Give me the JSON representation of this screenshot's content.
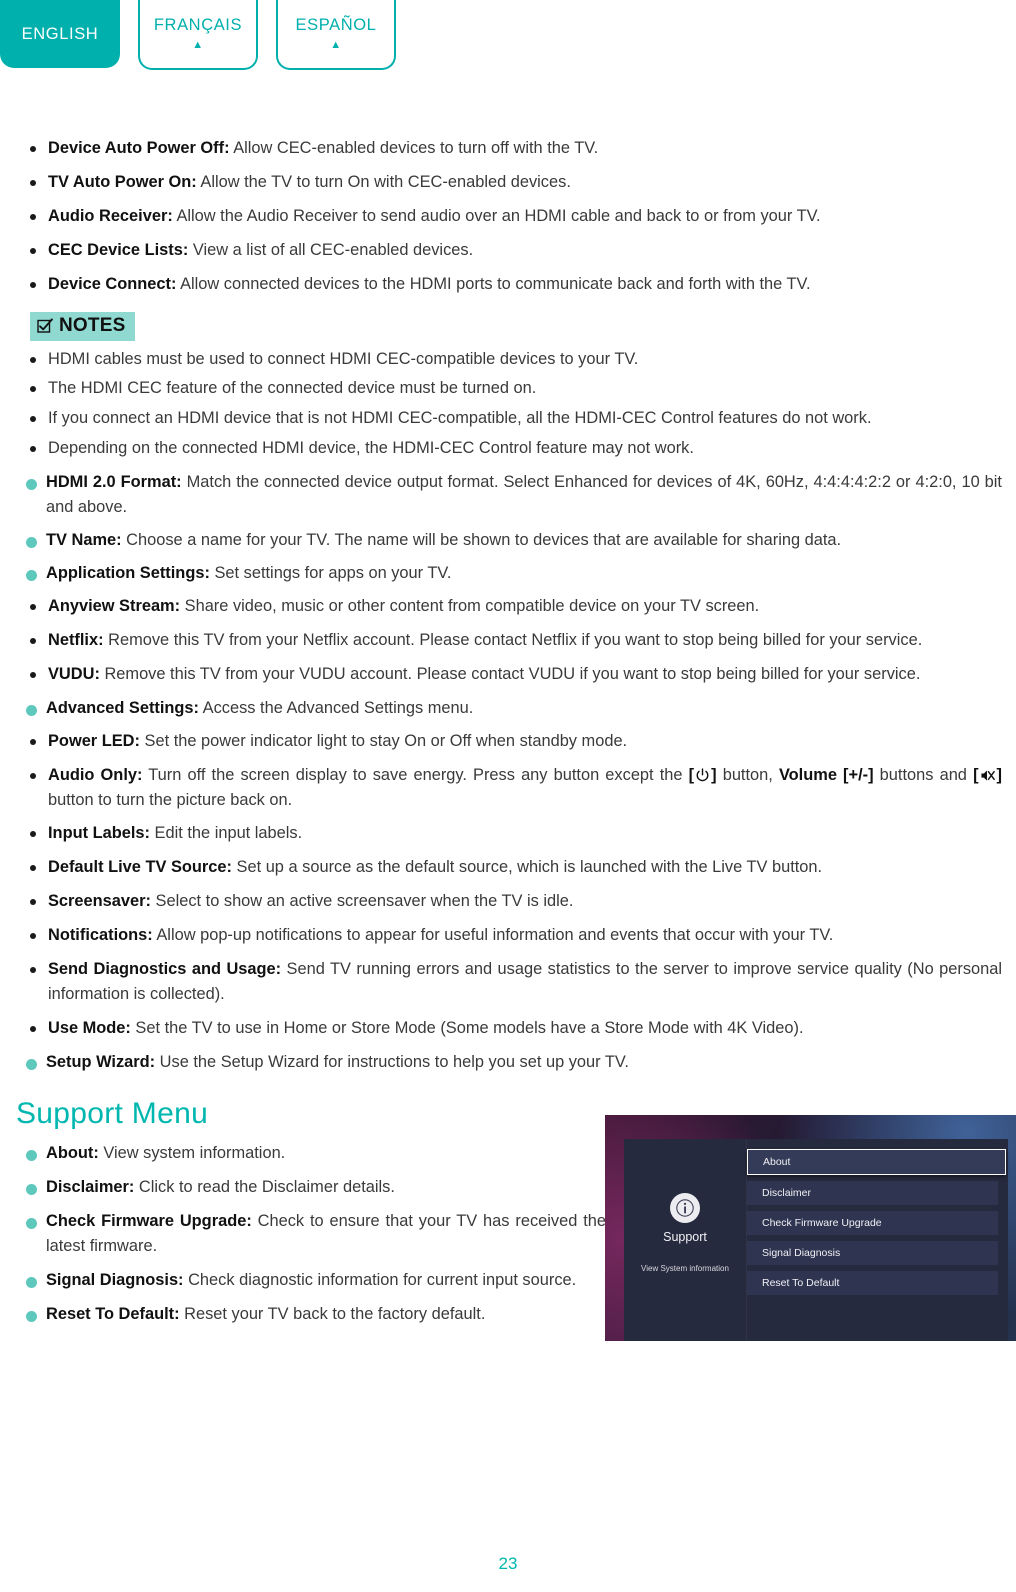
{
  "language_tabs": [
    {
      "label": "ENGLISH",
      "active": true,
      "caret": ""
    },
    {
      "label": "FRANÇAIS",
      "active": false,
      "caret": "▲"
    },
    {
      "label": "ESPAÑOL",
      "active": false,
      "caret": "▲"
    }
  ],
  "cec_items": [
    {
      "term": "Device Auto Power Off:",
      "desc": " Allow CEC-enabled devices to turn off with the TV."
    },
    {
      "term": "TV Auto Power On:",
      "desc": " Allow the TV to turn On with CEC-enabled devices."
    },
    {
      "term": "Audio Receiver:",
      "desc": " Allow the Audio Receiver to send audio over an HDMI cable and back to or from your TV."
    },
    {
      "term": "CEC Device Lists:",
      "desc": " View a list of all CEC-enabled devices."
    },
    {
      "term": "Device Connect:",
      "desc": " Allow connected devices to the HDMI ports to communicate back and forth with the TV."
    }
  ],
  "notes": {
    "badge_label": "NOTES",
    "badge_icon": "checkbox-pencil-icon",
    "items": [
      "HDMI cables must be used to connect HDMI CEC-compatible devices to your TV.",
      "The HDMI CEC feature of the connected device must be turned on.",
      "If you connect an HDMI device that is not HDMI CEC-compatible, all the HDMI-CEC Control features do not work.",
      "Depending on the connected HDMI device, the HDMI-CEC Control feature may not work."
    ]
  },
  "settings": {
    "hdmi_format": {
      "term": "HDMI 2.0 Format:",
      "desc": " Match the connected device output format. Select Enhanced for devices of 4K, 60Hz, 4:4:4:4:2:2 or 4:2:0, 10 bit and above."
    },
    "tv_name": {
      "term": "TV Name:",
      "desc": " Choose a name for your TV. The name will be shown to devices that are available for sharing data."
    },
    "application_settings": {
      "term": "Application Settings:",
      "desc": " Set settings for apps on your TV."
    },
    "application_sub": [
      {
        "term": "Anyview Stream:",
        "desc": " Share video, music or other content from compatible device on your TV screen."
      },
      {
        "term": "Netflix:",
        "desc": " Remove this TV from your Netflix account. Please contact Netflix if you want to stop being billed for your service."
      },
      {
        "term": "VUDU:",
        "desc": " Remove this TV from your VUDU account. Please contact VUDU if you want to stop being billed for your service."
      }
    ],
    "advanced_settings": {
      "term": "Advanced Settings:",
      "desc": " Access the Advanced Settings menu."
    },
    "power_led": {
      "term": "Power LED:",
      "desc": " Set the power indicator light to stay On or Off when standby mode."
    },
    "audio_only": {
      "term": "Audio Only:",
      "part1": " Turn off the screen display to save energy. Press any button except the ",
      "bracket_open": "[",
      "power_icon": "power-icon",
      "bracket_close": "]",
      "part2": " button, ",
      "volume_label": "Volume [+/-]",
      "part3": " buttons and ",
      "mute_icon": "mute-icon",
      "part4": " button to turn the picture back on."
    },
    "advanced_sub": [
      {
        "term": "Input Labels:",
        "desc": " Edit the input labels."
      },
      {
        "term": "Default Live TV Source:",
        "desc": " Set up a source as the default source, which is launched with the Live TV button."
      },
      {
        "term": "Screensaver:",
        "desc": " Select to show an active screensaver when the TV is idle."
      },
      {
        "term": "Notifications:",
        "desc": " Allow pop-up notifications to appear for useful information and events that occur with your TV."
      },
      {
        "term": "Send Diagnostics and Usage:",
        "desc": " Send TV running errors and usage statistics to the server to improve service quality (No personal information is collected)."
      },
      {
        "term": "Use Mode:",
        "desc": " Set the TV to use in Home or Store Mode (Some models have a Store Mode with 4K Video)."
      }
    ],
    "setup_wizard": {
      "term": "Setup Wizard:",
      "desc": " Use the Setup Wizard for instructions to help you set up your TV."
    }
  },
  "support_menu": {
    "heading": "Support Menu",
    "items": [
      {
        "term": "About:",
        "desc": " View system information."
      },
      {
        "term": "Disclaimer:",
        "desc": " Click to read the Disclaimer details."
      },
      {
        "term": "Check Firmware Upgrade:",
        "desc": " Check to ensure that your TV has received the latest firmware."
      },
      {
        "term": "Signal Diagnosis:",
        "desc": " Check diagnostic information for current input source."
      },
      {
        "term": "Reset To Default:",
        "desc": " Reset your TV back to the factory default."
      }
    ]
  },
  "tv_screenshot": {
    "icon": "info-circle-icon",
    "panel_title": "Support",
    "panel_subtitle": "View System information",
    "menu": [
      {
        "label": "About",
        "selected": true
      },
      {
        "label": "Disclaimer",
        "selected": false
      },
      {
        "label": "Check Firmware Upgrade",
        "selected": false
      },
      {
        "label": "Signal Diagnosis",
        "selected": false
      },
      {
        "label": "Reset To Default",
        "selected": false
      }
    ]
  },
  "page_number": "23",
  "colors": {
    "accent_teal": "#00b0ad",
    "bullet_teal": "#5ec8bd",
    "notes_badge_bg": "#8fd9d0",
    "tv_panel_bg": "#262a3f",
    "tv_item_bg": "#2f3551"
  }
}
